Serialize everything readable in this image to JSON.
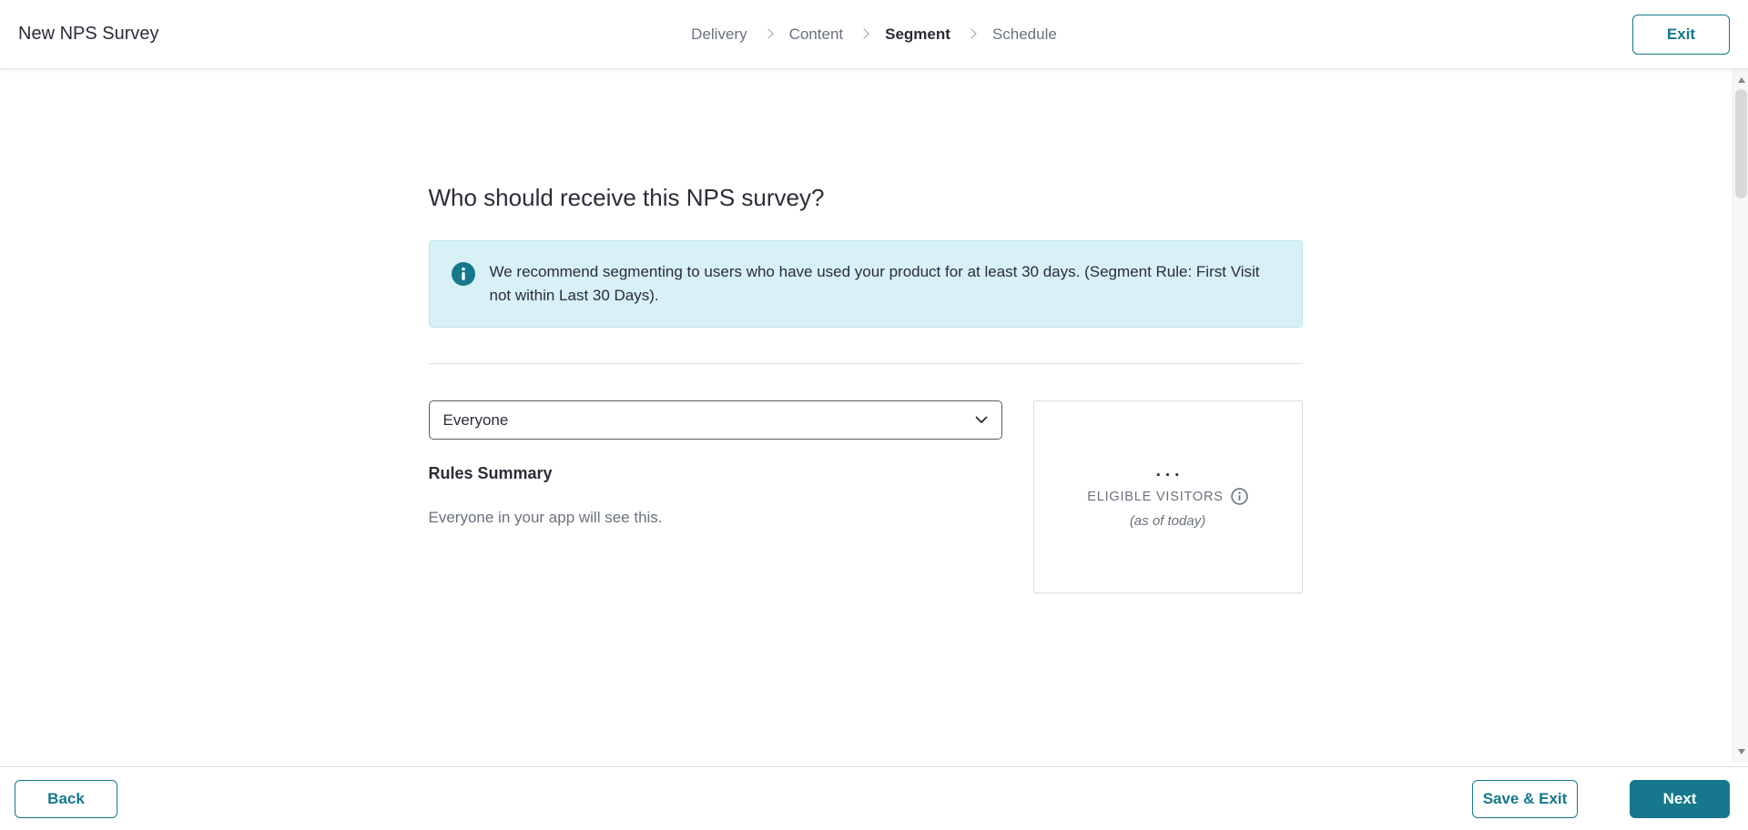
{
  "header": {
    "title": "New NPS Survey",
    "breadcrumb": [
      {
        "label": "Delivery",
        "active": false
      },
      {
        "label": "Content",
        "active": false
      },
      {
        "label": "Segment",
        "active": true
      },
      {
        "label": "Schedule",
        "active": false
      }
    ],
    "exit_label": "Exit"
  },
  "main": {
    "heading": "Who should receive this NPS survey?",
    "info_banner": {
      "icon": "info-circle-filled",
      "text": "We recommend segmenting to users who have used your product for at least 30 days. (Segment Rule: First Visit not within Last 30 Days)."
    },
    "segment_select": {
      "value": "Everyone",
      "icon": "chevron-down"
    },
    "rules_summary": {
      "title": "Rules Summary",
      "description": "Everyone in your app will see this."
    },
    "eligible_card": {
      "count_placeholder": "...",
      "label": "ELIGIBLE VISITORS",
      "info_icon": "info-circle-outline",
      "note": "(as of today)"
    }
  },
  "footer": {
    "back_label": "Back",
    "save_exit_label": "Save & Exit",
    "next_label": "Next"
  },
  "colors": {
    "teal": "#15788C",
    "banner_bg": "#D7F1F6",
    "banner_border": "#BCE6EE",
    "text_dark": "#2A2D37",
    "text_gray": "#6A717E",
    "border_gray": "#DCDDE0"
  }
}
